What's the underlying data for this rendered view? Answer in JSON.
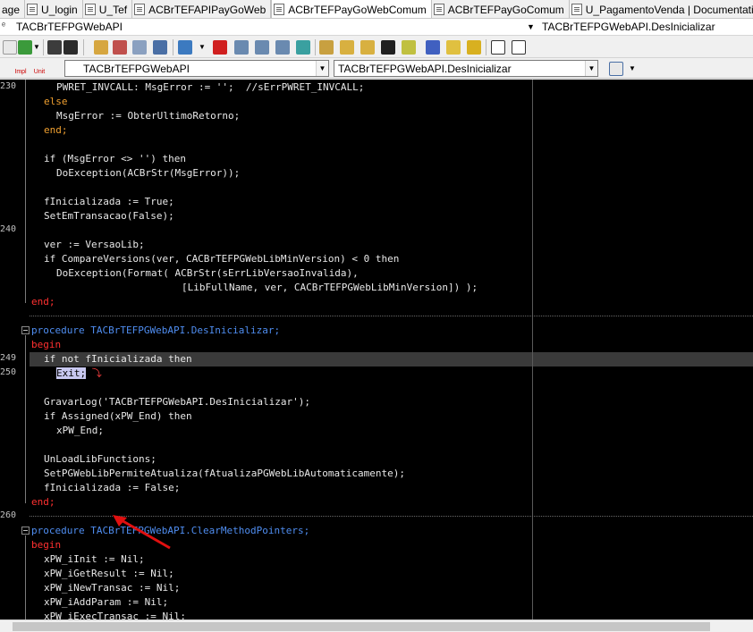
{
  "tabs": [
    {
      "label": "age",
      "active": false
    },
    {
      "label": "U_login",
      "active": false
    },
    {
      "label": "U_Tef",
      "active": false
    },
    {
      "label": "ACBrTEFAPIPayGoWeb",
      "active": false
    },
    {
      "label": "ACBrTEFPayGoWebComum",
      "active": true
    },
    {
      "label": "ACBrTEFPayGoComum",
      "active": false
    },
    {
      "label": "U_PagamentoVenda | Documentation",
      "active": false
    }
  ],
  "titlebar": {
    "left_small": "ᵉ",
    "class_name": "TACBrTEFPGWebAPI",
    "method_name": "TACBrTEFPGWebAPI.DesInicializar"
  },
  "combos": {
    "class_selected": "TACBrTEFPGWebAPI",
    "method_selected": "TACBrTEFPGWebAPI.DesInicializar"
  },
  "impl_buttons": [
    {
      "label": "Impl"
    },
    {
      "label": "Unit"
    }
  ],
  "gutter": {
    "line_230": "230",
    "line_240": "240",
    "line_249": "249",
    "line_250": "250",
    "line_260": "260"
  },
  "code_lines": [
    "PWRET_INVCALL: MsgError := '';  //sErrPWRET_INVCALL;",
    "else",
    "MsgError := ObterUltimoRetorno;",
    "end;",
    "",
    "if (MsgError <> '') then",
    "DoException(ACBrStr(MsgError));",
    "",
    "fInicializada := True;",
    "SetEmTransacao(False);",
    "",
    "ver := VersaoLib;",
    "if CompareVersions(ver, CACBrTEFPGWebLibMinVersion) < 0 then",
    "DoException(Format( ACBrStr(sErrLibVersaoInvalida),",
    "[LibFullName, ver, CACBrTEFPGWebLibMinVersion]) );",
    "end;",
    "",
    "procedure TACBrTEFPGWebAPI.DesInicializar;",
    "begin",
    "if not fInicializada then",
    "Exit;",
    "",
    "GravarLog('TACBrTEFPGWebAPI.DesInicializar');",
    "if Assigned(xPW_End) then",
    "xPW_End;",
    "",
    "UnLoadLibFunctions;",
    "SetPGWebLibPermiteAtualiza(fAtualizaPGWebLibAutomaticamente);",
    "fInicializada := False;",
    "end;",
    "",
    "procedure TACBrTEFPGWebAPI.ClearMethodPointers;",
    "begin",
    "xPW_iInit := Nil;",
    "xPW_iGetResult := Nil;",
    "xPW_iNewTransac := Nil;",
    "xPW_iAddParam := Nil;",
    "xPW_iExecTransac := Nil;"
  ],
  "colors": {
    "keyword": "#f0a030",
    "builtin": "#4f8df0",
    "string": "#f0c000",
    "comment": "#38c038",
    "begin_end": "#ff3030",
    "background": "#000000",
    "annotation_arrow": "#e01010"
  }
}
